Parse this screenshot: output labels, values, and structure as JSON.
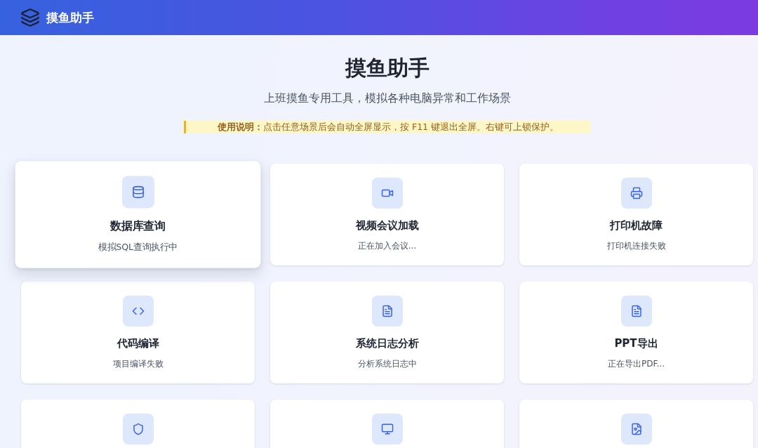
{
  "header": {
    "title": "摸鱼助手"
  },
  "hero": {
    "title": "摸鱼助手",
    "subtitle": "上班摸鱼专用工具，模拟各种电脑异常和工作场景"
  },
  "notice": {
    "text": "**使用说明：**点击任意场景后会自动全屏显示，按 F11 键退出全屏。右键可上锁保护。"
  },
  "scenarios": [
    {
      "title": "数据库查询",
      "description": "模拟SQL查询执行中",
      "hovered": true
    },
    {
      "title": "视频会议加载",
      "description": "正在加入会议...",
      "hovered": false
    },
    {
      "title": "打印机故障",
      "description": "打印机连接失败",
      "hovered": false
    },
    {
      "title": "代码编译",
      "description": "项目编译失败",
      "hovered": false
    },
    {
      "title": "系统日志分析",
      "description": "分析系统日志中",
      "hovered": false
    },
    {
      "title": "PPT导出",
      "description": "正在导出PDF...",
      "hovered": false
    },
    {
      "hovered": false
    },
    {
      "hovered": false
    },
    {
      "hovered": false
    }
  ]
}
